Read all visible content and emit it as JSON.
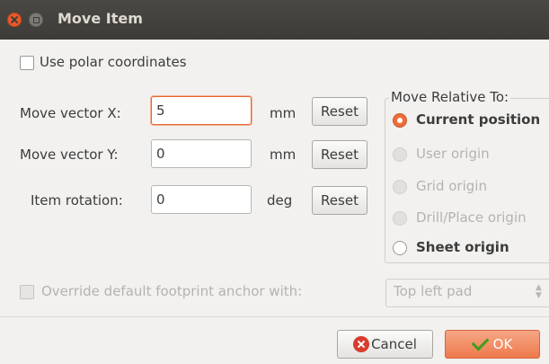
{
  "window": {
    "title": "Move Item"
  },
  "polar": {
    "label": "Use polar coordinates",
    "checked": false
  },
  "fields": {
    "x": {
      "label": "Move vector X:",
      "value": "5",
      "unit": "mm",
      "reset": "Reset"
    },
    "y": {
      "label": "Move vector Y:",
      "value": "0",
      "unit": "mm",
      "reset": "Reset"
    },
    "rot": {
      "label": "Item rotation:",
      "value": "0",
      "unit": "deg",
      "reset": "Reset"
    }
  },
  "relative": {
    "title": "Move Relative To:",
    "options": [
      {
        "label": "Current position",
        "state": "selected"
      },
      {
        "label": "User origin",
        "state": "disabled"
      },
      {
        "label": "Grid origin",
        "state": "disabled"
      },
      {
        "label": "Drill/Place origin",
        "state": "disabled"
      },
      {
        "label": "Sheet origin",
        "state": "enabled"
      }
    ]
  },
  "anchor": {
    "label": "Override default footprint anchor with:",
    "checked": false,
    "disabled": true,
    "value": "Top left pad"
  },
  "buttons": {
    "cancel": "Cancel",
    "ok": "OK"
  },
  "colors": {
    "accent": "#ee6d3b",
    "titlebar": "#3d3c38",
    "cancel_icon": "#d73c2c",
    "ok_check": "#3c9e1c"
  }
}
